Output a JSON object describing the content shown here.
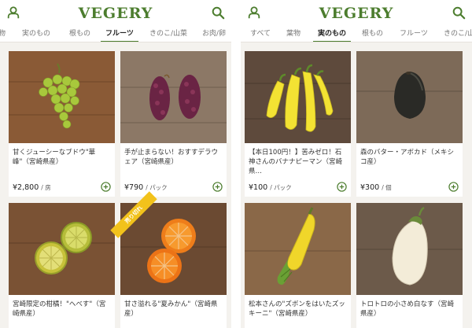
{
  "app": {
    "logo": "VEGERY",
    "accent_color": "#4c7d2e",
    "icons": {
      "left": "user-icon",
      "right": "search-icon",
      "add": "add-circle-icon"
    }
  },
  "left_screen": {
    "tabs": [
      {
        "label": "物"
      },
      {
        "label": "実のもの"
      },
      {
        "label": "根もの"
      },
      {
        "label": "フルーツ",
        "active": true
      },
      {
        "label": "きのこ/山菜"
      },
      {
        "label": "お肉/卵"
      }
    ],
    "products": [
      {
        "title": "甘くジューシーなブドウ\"華峰\"（宮崎県産）",
        "price": "¥2,800",
        "unit": "/ 房"
      },
      {
        "title": "手が止まらない！おすすデラウェア（宮崎県産）",
        "price": "¥790",
        "unit": "/ パック"
      },
      {
        "title": "宮崎限定の柑橘！\"へべす\"（宮崎県産）",
        "price": "",
        "unit": ""
      },
      {
        "title": "甘さ溢れる\"夏みかん\"（宮崎県産）",
        "price": "",
        "unit": "",
        "badge": "売り切れ"
      }
    ]
  },
  "right_screen": {
    "tabs": [
      {
        "label": "すべて"
      },
      {
        "label": "葉物"
      },
      {
        "label": "実のもの",
        "active": true
      },
      {
        "label": "根もの"
      },
      {
        "label": "フルーツ"
      },
      {
        "label": "きのこ/山"
      }
    ],
    "products": [
      {
        "title": "【本日100円！】苦みゼロ！石神さんのバナナピーマン（宮崎県…",
        "price": "¥100",
        "unit": "/ パック"
      },
      {
        "title": "森のバター・アボカド（メキシコ産）",
        "price": "¥300",
        "unit": "/ 個"
      },
      {
        "title": "松本さんの\"ズボンをはいたズッキーニ\"（宮崎県産）",
        "price": "",
        "unit": ""
      },
      {
        "title": "トロトロの小さめ白なす（宮崎県産）",
        "price": "",
        "unit": ""
      }
    ]
  }
}
